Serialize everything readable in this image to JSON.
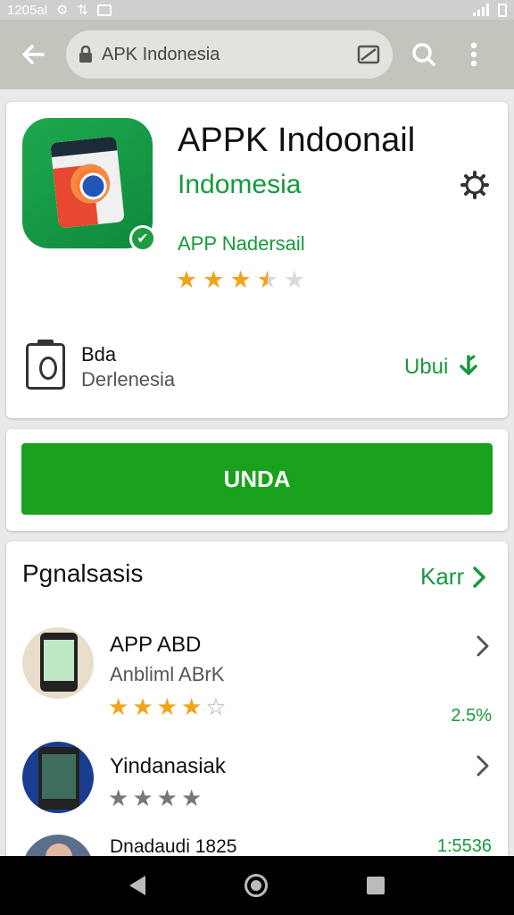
{
  "status_bar": {
    "time": "1205al",
    "icon1": "notification-icon",
    "icon2": "data-icon",
    "battery": "battery-icon",
    "signal": "signal-icon"
  },
  "toolbar": {
    "url": "APK Indonesia",
    "back_icon": "back-arrow-icon",
    "lock_icon": "lock-icon",
    "tabs_icon": "tabs-icon",
    "search_icon": "search-icon",
    "menu_icon": "more-vert-icon"
  },
  "app": {
    "title": "APPK Indoonail",
    "subtitle": "Indomesia",
    "developer": "APP Nadersail",
    "rating": 3.5,
    "rating_max": 5,
    "meta_line1": "Bda",
    "meta_line2": "Derlenesia",
    "update_label": "Ubui"
  },
  "install": {
    "label": "UNDA"
  },
  "section": {
    "title": "Pgnalsasis",
    "see_more": "Karr"
  },
  "list": [
    {
      "name": "APP ABD",
      "sub": "Anbliml ABrK",
      "rating": 4,
      "rating_max": 5,
      "meta": "2.5%"
    },
    {
      "name": "Yindanasiak",
      "rating": 4,
      "rating_max": 4
    },
    {
      "name": "Dnadaudi 1825",
      "meta": "1:5536"
    }
  ],
  "colors": {
    "accent_green": "#17993c",
    "button_green": "#19a01c",
    "star_gold": "#f0a417"
  }
}
